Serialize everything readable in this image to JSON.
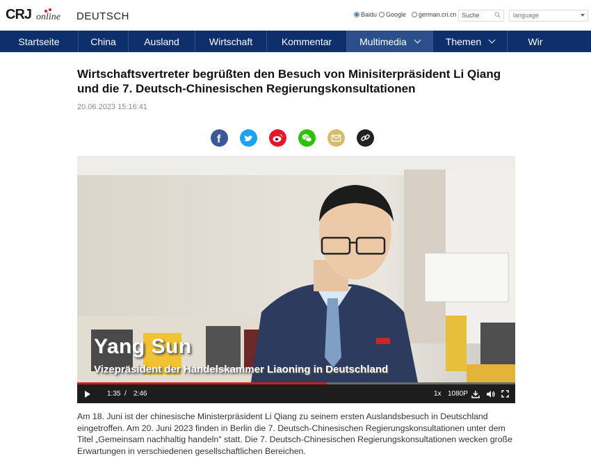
{
  "header": {
    "logo_text": "CRI online",
    "site_language": "DEUTSCH",
    "search_engines": [
      {
        "label": "Baidu",
        "selected": true
      },
      {
        "label": "Google",
        "selected": false
      },
      {
        "label": "german.cri.cn",
        "selected": false
      }
    ],
    "search_placeholder": "Suche",
    "language_select": "language"
  },
  "nav": {
    "items": [
      {
        "label": "Startseite"
      },
      {
        "label": "China"
      },
      {
        "label": "Ausland"
      },
      {
        "label": "Wirtschaft"
      },
      {
        "label": "Kommentar"
      },
      {
        "label": "Multimedia",
        "active": true,
        "dropdown": true
      },
      {
        "label": "Themen",
        "dropdown": true
      },
      {
        "label": "Wir"
      }
    ]
  },
  "article": {
    "title": "Wirtschaftsvertreter begrüßten den Besuch von Minisiterpräsident Li Qiang und die 7. Deutsch-Chinesischen Regierungskonsultationen",
    "date": "20.06.2023 15:16:41",
    "share_icons": [
      "facebook-icon",
      "twitter-icon",
      "weibo-icon",
      "wechat-icon",
      "email-icon",
      "link-icon"
    ],
    "body": "Am 18. Juni ist der chinesische Ministerpräsident Li Qiang zu seinem ersten Auslandsbesuch in Deutschland eingetroffen. Am 20. Juni 2023 finden in Berlin die 7. Deutsch-Chinesischen Regierungskonsultationen unter dem Titel „Gemeinsam nachhaltig handeln\" statt. Die 7. Deutsch-Chinesischen Regierungskonsultationen wecken große Erwartungen in verschiedenen gesellschaftlichen Bereichen."
  },
  "video": {
    "caption_name": "Yang Sun",
    "caption_role": "Vizepräsident der Handelskammer Liaoning in Deutschland",
    "current_time": "1:35",
    "separator": "/",
    "duration": "2:46",
    "progress_fraction": 0.57,
    "speed": "1x",
    "quality": "1080P"
  },
  "colors": {
    "nav_bg": "#0d2f6c",
    "nav_active": "#2a4f8a",
    "accent_red": "#d21b1b"
  }
}
